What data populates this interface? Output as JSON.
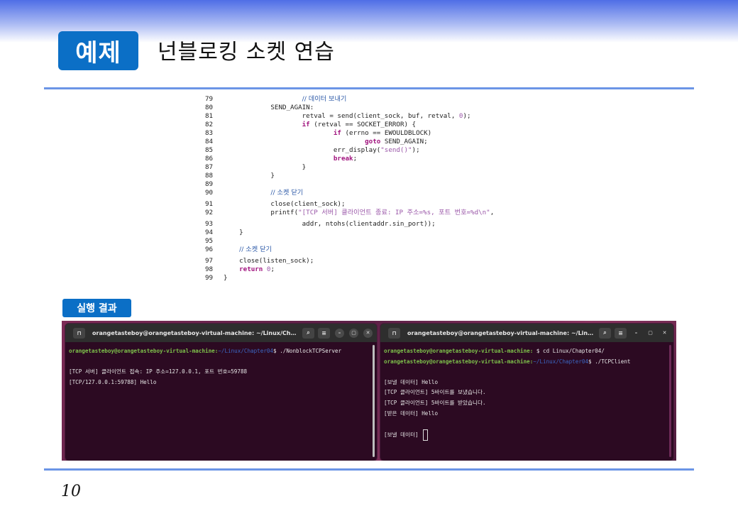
{
  "slide": {
    "badge": "예제",
    "title": "넌블로킹 소켓 연습",
    "result_badge": "실행 결과",
    "page_number": "10"
  },
  "code": {
    "lines": [
      {
        "n": "79",
        "parts": [
          {
            "t": "                    ",
            "c": ""
          },
          {
            "t": "// 데이터 보내기",
            "c": "cm"
          }
        ]
      },
      {
        "n": "80",
        "parts": [
          {
            "t": "            SEND_AGAIN:",
            "c": ""
          }
        ]
      },
      {
        "n": "81",
        "parts": [
          {
            "t": "                    retval = send(client_sock, buf, retval, ",
            "c": ""
          },
          {
            "t": "0",
            "c": "nm"
          },
          {
            "t": ");",
            "c": ""
          }
        ]
      },
      {
        "n": "82",
        "parts": [
          {
            "t": "                    ",
            "c": ""
          },
          {
            "t": "if",
            "c": "kw"
          },
          {
            "t": " (retval == SOCKET_ERROR) {",
            "c": ""
          }
        ]
      },
      {
        "n": "83",
        "parts": [
          {
            "t": "                            ",
            "c": ""
          },
          {
            "t": "if",
            "c": "kw"
          },
          {
            "t": " (errno == EWOULDBLOCK)",
            "c": ""
          }
        ]
      },
      {
        "n": "84",
        "parts": [
          {
            "t": "                                    ",
            "c": ""
          },
          {
            "t": "goto",
            "c": "kw"
          },
          {
            "t": " SEND_AGAIN;",
            "c": ""
          }
        ]
      },
      {
        "n": "85",
        "parts": [
          {
            "t": "                            err_display(",
            "c": ""
          },
          {
            "t": "\"send()\"",
            "c": "st"
          },
          {
            "t": ");",
            "c": ""
          }
        ]
      },
      {
        "n": "86",
        "parts": [
          {
            "t": "                            ",
            "c": ""
          },
          {
            "t": "break",
            "c": "kw"
          },
          {
            "t": ";",
            "c": ""
          }
        ]
      },
      {
        "n": "87",
        "parts": [
          {
            "t": "                    }",
            "c": ""
          }
        ]
      },
      {
        "n": "88",
        "parts": [
          {
            "t": "            }",
            "c": ""
          }
        ]
      },
      {
        "n": "89",
        "parts": []
      },
      {
        "n": "90",
        "parts": [
          {
            "t": "            ",
            "c": ""
          },
          {
            "t": "// 소켓 닫기",
            "c": "cm"
          }
        ]
      },
      {
        "n": "91",
        "gap": true,
        "parts": [
          {
            "t": "            close(client_sock);",
            "c": ""
          }
        ]
      },
      {
        "n": "92",
        "parts": [
          {
            "t": "            printf(",
            "c": ""
          },
          {
            "t": "\"[TCP 서버] 클라이언트 종료: IP 주소=%s, 포트 번호=%d\\n\"",
            "c": "st"
          },
          {
            "t": ",",
            "c": ""
          }
        ]
      },
      {
        "n": "93",
        "gap": true,
        "parts": [
          {
            "t": "                    addr, ntohs(clientaddr.sin_port));",
            "c": ""
          }
        ]
      },
      {
        "n": "94",
        "parts": [
          {
            "t": "    }",
            "c": ""
          }
        ]
      },
      {
        "n": "95",
        "parts": []
      },
      {
        "n": "96",
        "parts": [
          {
            "t": "    ",
            "c": ""
          },
          {
            "t": "// 소켓 닫기",
            "c": "cm"
          }
        ]
      },
      {
        "n": "97",
        "gap": true,
        "parts": [
          {
            "t": "    close(listen_sock);",
            "c": ""
          }
        ]
      },
      {
        "n": "98",
        "parts": [
          {
            "t": "    ",
            "c": ""
          },
          {
            "t": "return",
            "c": "kw"
          },
          {
            "t": " ",
            "c": ""
          },
          {
            "t": "0",
            "c": "nm"
          },
          {
            "t": ";",
            "c": ""
          }
        ]
      },
      {
        "n": "99",
        "parts": [
          {
            "t": "}",
            "c": ""
          }
        ]
      }
    ]
  },
  "terminals": {
    "server": {
      "title": "orangetasteboy@orangetasteboy-virtual-machine: ~/Linux/Chapte...",
      "prompt_user": "orangetasteboy@orangetasteboy-virtual-machine:",
      "prompt_path": "~/Linux/Chapter04",
      "command": "$ ./NonblockTCPServer",
      "output": [
        "",
        "[TCP 서버] 클라이언트 접속: IP 주소=127.0.0.1, 포트 번호=59788",
        "[TCP/127.0.0.1:59788] Hello"
      ]
    },
    "client": {
      "title": "orangetasteboy@orangetasteboy-virtual-machine: ~/Linux/C...",
      "line1_user": "orangetasteboy@orangetasteboy-virtual-machine:",
      "line1_cmd": " $ cd Linux/Chapter04/",
      "line2_user": "orangetasteboy@orangetasteboy-virtual-machine:",
      "line2_path": "~/Linux/Chapter04",
      "line2_cmd": "$ ./TCPClient",
      "output": [
        "",
        "[보낼 데이터] Hello",
        "[TCP 클라이언트] 5바이트를 보냈습니다.",
        "[TCP 클라이언트] 5바이트를 받았습니다.",
        "[받은 데이터] Hello",
        ""
      ],
      "last_prompt": "[보낼 데이터] "
    },
    "buttons": {
      "newtab": "⊓",
      "search": "⌕",
      "menu": "≡",
      "minimize": "–",
      "maximize": "▢",
      "close": "✕"
    }
  }
}
